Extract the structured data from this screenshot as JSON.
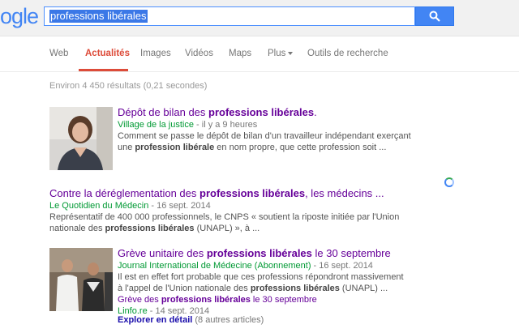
{
  "logo": "ogle",
  "search": {
    "value": "professions libérales"
  },
  "tabs": [
    {
      "label": "Web"
    },
    {
      "label": "Actualités"
    },
    {
      "label": "Images"
    },
    {
      "label": "Vidéos"
    },
    {
      "label": "Maps"
    },
    {
      "label": "Plus"
    },
    {
      "label": "Outils de recherche"
    }
  ],
  "stats": "Environ 4 450 résultats (0,21 secondes)",
  "results": [
    {
      "title_a": "Dépôt de bilan des ",
      "title_b": "professions libérales",
      "title_c": ".",
      "source": "Village de la justice",
      "ago": " - il y a 9 heures",
      "snip1": "Comment se passe le dépôt de bilan d'un travailleur indépendant exerçant",
      "snip2a": "une ",
      "snip2b": "profession libérale",
      "snip2c": " en nom propre, que cette profession soit ..."
    },
    {
      "title_a": "Contre la déréglementation des ",
      "title_b": "professions libérales",
      "title_c": ", les médecins ...",
      "source": "Le Quotidien du Médecin",
      "ago": " - 16 sept. 2014",
      "snip1": "Représentatif de 400 000 professionnels, le CNPS « soutient la riposte initiée par l'Union",
      "snip2a": "nationale des ",
      "snip2b": "professions libérales",
      "snip2c": " (UNAPL) », à ..."
    },
    {
      "title_a": "Grève unitaire des ",
      "title_b": "professions libérales",
      "title_c": " le 30 septembre",
      "source": "Journal International de Médecine (Abonnement)",
      "ago": " - 16 sept. 2014",
      "snip1": "Il est en effet fort probable que ces professions répondront massivement",
      "snip2a": "à l'appel de l'Union nationale des ",
      "snip2b": "professions libérales",
      "snip2c": " (UNAPL) ...",
      "sub_a": "Grève des ",
      "sub_b": "professions libérales",
      "sub_c": " le 30 septembre",
      "sub_source": "Linfo.re",
      "sub_ago": " - 14 sept. 2014"
    }
  ],
  "more": {
    "link": "Explorer en détail",
    "count": " (8 autres articles)"
  }
}
